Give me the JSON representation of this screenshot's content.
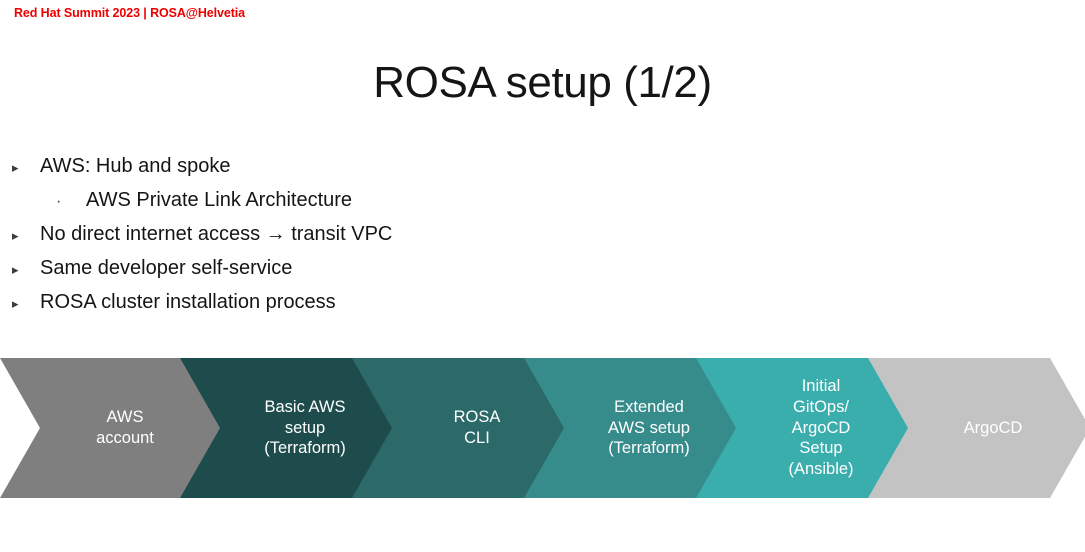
{
  "header": {
    "text": "Red Hat Summit 2023 | ROSA@Helvetia",
    "color": "#ee0000"
  },
  "title": {
    "text": "ROSA setup (1/2)"
  },
  "bullets": [
    {
      "level": 1,
      "marker": "▸",
      "text": "AWS: Hub and spoke"
    },
    {
      "level": 2,
      "marker": "·",
      "text": "AWS Private Link Architecture"
    },
    {
      "level": 1,
      "marker": "▸",
      "text": "No direct internet access → transit VPC"
    },
    {
      "level": 1,
      "marker": "▸",
      "text": "Same developer self-service"
    },
    {
      "level": 1,
      "marker": "▸",
      "text": "ROSA cluster installation process"
    }
  ],
  "process_flow": {
    "steps": [
      {
        "label": "AWS\naccount",
        "color": "#7f7f7f"
      },
      {
        "label": "Basic AWS\nsetup\n(Terraform)",
        "color": "#1e4c4c"
      },
      {
        "label": "ROSA\nCLI",
        "color": "#2c6a6a"
      },
      {
        "label": "Extended\nAWS setup\n(Terraform)",
        "color": "#368b8b"
      },
      {
        "label": "Initial\nGitOps/\nArgoCD\nSetup\n(Ansible)",
        "color": "#3aadad"
      },
      {
        "label": "ArgoCD",
        "color": "#c3c3c3"
      }
    ]
  }
}
